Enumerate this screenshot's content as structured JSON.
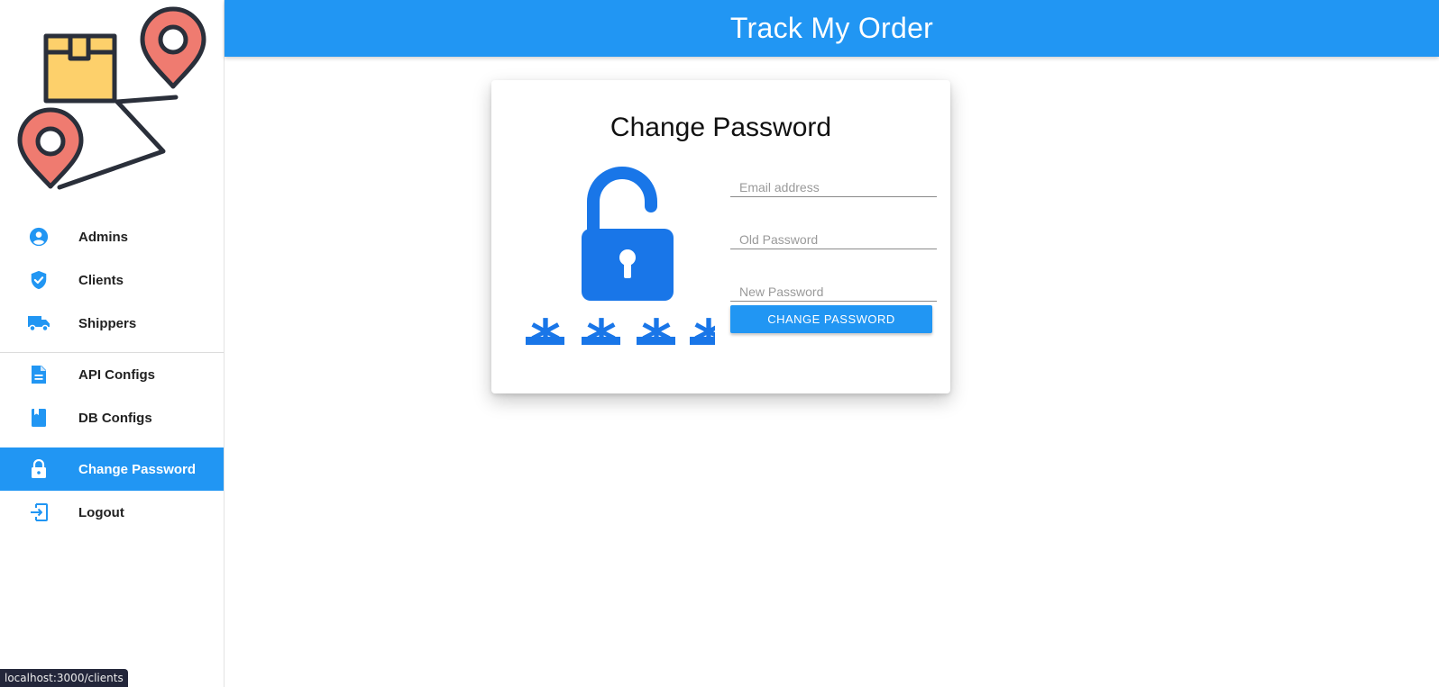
{
  "app": {
    "title": "Track My Order",
    "accent_color": "#2196f3"
  },
  "sidebar": {
    "logo": {
      "icons": [
        "package-box-icon",
        "location-pin-icon",
        "location-pin-icon",
        "route-line-icon"
      ]
    },
    "items": [
      {
        "label": "Admins",
        "icon": "account-circle-icon",
        "active": false
      },
      {
        "label": "Clients",
        "icon": "verified-shield-icon",
        "active": false
      },
      {
        "label": "Shippers",
        "icon": "truck-icon",
        "active": false
      },
      {
        "label": "API Configs",
        "icon": "document-icon",
        "active": false
      },
      {
        "label": "DB Configs",
        "icon": "book-icon",
        "active": false
      },
      {
        "label": "Change Password",
        "icon": "lock-icon",
        "active": true
      },
      {
        "label": "Logout",
        "icon": "logout-icon",
        "active": false
      }
    ]
  },
  "card": {
    "title": "Change Password",
    "illustration_icon": "unlocked-padlock-password-icon",
    "fields": {
      "email": {
        "placeholder": "Email address",
        "value": ""
      },
      "old_password": {
        "placeholder": "Old Password",
        "value": ""
      },
      "new_password": {
        "placeholder": "New Password",
        "value": ""
      }
    },
    "submit_label": "Change Password"
  },
  "status_bar": {
    "url": "localhost:3000/clients"
  }
}
